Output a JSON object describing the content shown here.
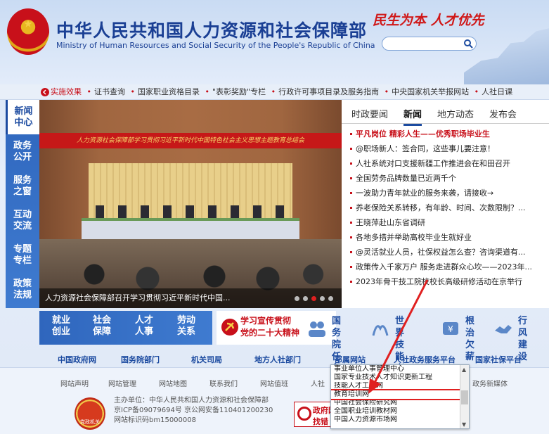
{
  "header": {
    "title": "中华人民共和国人力资源和社会保障部",
    "title_en": "Ministry of Human Resources and Social Security of the People's Republic of China",
    "slogan": "民生为本 人才优先",
    "search_placeholder": ""
  },
  "ticker": {
    "first": "实施效果",
    "items": [
      "证书查询",
      "国家职业资格目录",
      "\"表彰奖励\"专栏",
      "行政许可事项目录及服务指南",
      "中央国家机关举报网站",
      "人社日课"
    ]
  },
  "leftnav": [
    {
      "label": "新闻\n中心"
    },
    {
      "label": "政务\n公开"
    },
    {
      "label": "服务\n之窗"
    },
    {
      "label": "互动\n交流"
    },
    {
      "label": "专题\n专栏"
    },
    {
      "label": "政策\n法规"
    }
  ],
  "photo": {
    "banner": "人力资源社会保障部学习贯彻习近平新时代中国特色社会主义思想主题教育总结会",
    "caption": "人力资源社会保障部召开学习贯彻习近平新时代中国..."
  },
  "news": {
    "tabs": [
      "时政要闻",
      "新闻",
      "地方动态",
      "发布会"
    ],
    "items": [
      "平凡岗位 精彩人生——优秀职场毕业生",
      "@职场新人：签合同，这些事儿要注意！",
      "人社系统对口支援新疆工作推进会在和田召开",
      "全国劳务品牌数量已近两千个",
      "一波助力青年就业的服务来袭，请接收→",
      "养老保险关系转移，有年龄、时间、次数限制？...",
      "王晓萍赴山东省调研",
      "各地多措并举助高校毕业生就好业",
      "@灵活就业人员，社保权益怎么查？咨询渠道有...",
      "政策传入千家万户 服务走进群众心坎——2023年...",
      "2023年骨干技工院校校长高级研修活动在京举行"
    ]
  },
  "services": {
    "blue": [
      {
        "label": "就业\n创业"
      },
      {
        "label": "社会\n保障"
      },
      {
        "label": "人才\n人事"
      },
      {
        "label": "劳动\n关系"
      }
    ],
    "party": "学习宣传贯彻\n党的二十大精神",
    "icons": [
      {
        "label": "国务院\n任  免"
      },
      {
        "label": "世界技能\n大  赛"
      },
      {
        "label": "根治\n欠薪"
      },
      {
        "label": "行风\n建设"
      }
    ]
  },
  "linkbar": [
    "中国政府网",
    "国务院部门",
    "机关司局",
    "地方人社部门",
    "部属网站",
    "人社政务服务平台",
    "国家社保平台"
  ],
  "footer": {
    "links": [
      "网站声明",
      "网站管理",
      "网站地图",
      "联系我们",
      "网站值班",
      "人社",
      "政务新媒体"
    ],
    "info": [
      "主办单位：中华人民共和国人力资源和社会保障部",
      "京ICP备09079694号 京公网安备110401200230",
      "网站标识码bm15000008"
    ],
    "police_label": "党政机关",
    "gov_badge": [
      "政府网站",
      "找错"
    ]
  },
  "dropdown": {
    "items": [
      "事业单位人事管理中心",
      "国家专业技术人才知识更新工程",
      "技能人才工作网",
      "教育培训网",
      "中国社会保险研究网",
      "全国职业培训教材网",
      "中国人力资源市场网"
    ],
    "highlighted_index": 3
  },
  "colors": {
    "brand_blue": "#1a3f94",
    "accent_red": "#c8101a",
    "nav_blue": "#2f66bd"
  }
}
